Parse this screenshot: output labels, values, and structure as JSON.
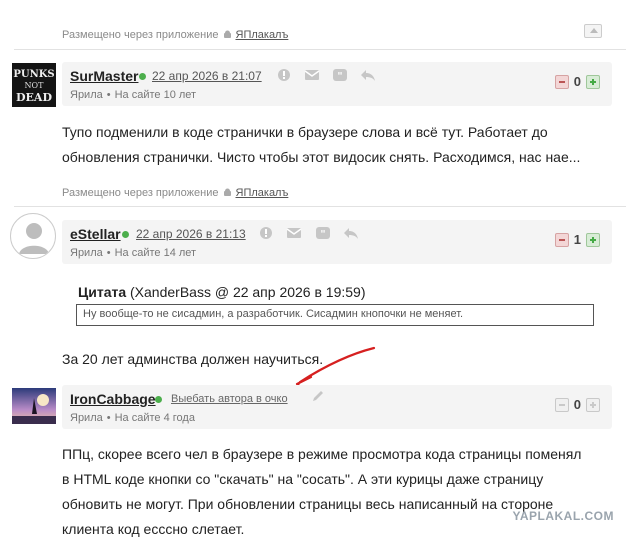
{
  "posted_via_label": "Размещено через приложение",
  "app_name": "ЯПлакалъ",
  "comments": [
    {
      "username": "SurMaster",
      "timestamp": "22 апр 2026 в 21:07",
      "location": "Ярила",
      "on_site": "На сайте 10 лет",
      "score": "0",
      "avatar_text": "PUNKS NOT DEAD",
      "text": "Тупо подменили в коде странички в браузере слова и всё тут. Работает до обновления странички. Чисто чтобы этот видосик снять. Расходимся, нас нае..."
    },
    {
      "username": "eStellar",
      "timestamp": "22 апр 2026 в 21:13",
      "location": "Ярила",
      "on_site": "На сайте 14 лет",
      "score": "1",
      "quote_label": "Цитата",
      "quote_source": "(XanderBass @ 22 апр 2026 в 19:59)",
      "quote_text": "Ну вообще-то не сисадмин, а разработчик. Сисадмин кнопочки не меняет.",
      "text": "За 20 лет админства должен научиться."
    },
    {
      "username": "IronCabbage",
      "action_link": "Выебать автора в очко",
      "location": "Ярила",
      "on_site": "На сайте 4 года",
      "score": "0",
      "text": "ППц, скорее всего чел в браузере в режиме просмотра кода страницы поменял в HTML коде кнопки со \"скачать\" на \"сосать\". А эти курицы даже страницу обновить не могут. При обновлении страницы весь написанный на стороне клиента код есссно слетает."
    }
  ],
  "watermark": "YAPLAKAL.COM",
  "colors": {
    "online": "#4cae4c",
    "annotation_arrow": "#d62020",
    "header_bg": "#f4f4f4"
  }
}
